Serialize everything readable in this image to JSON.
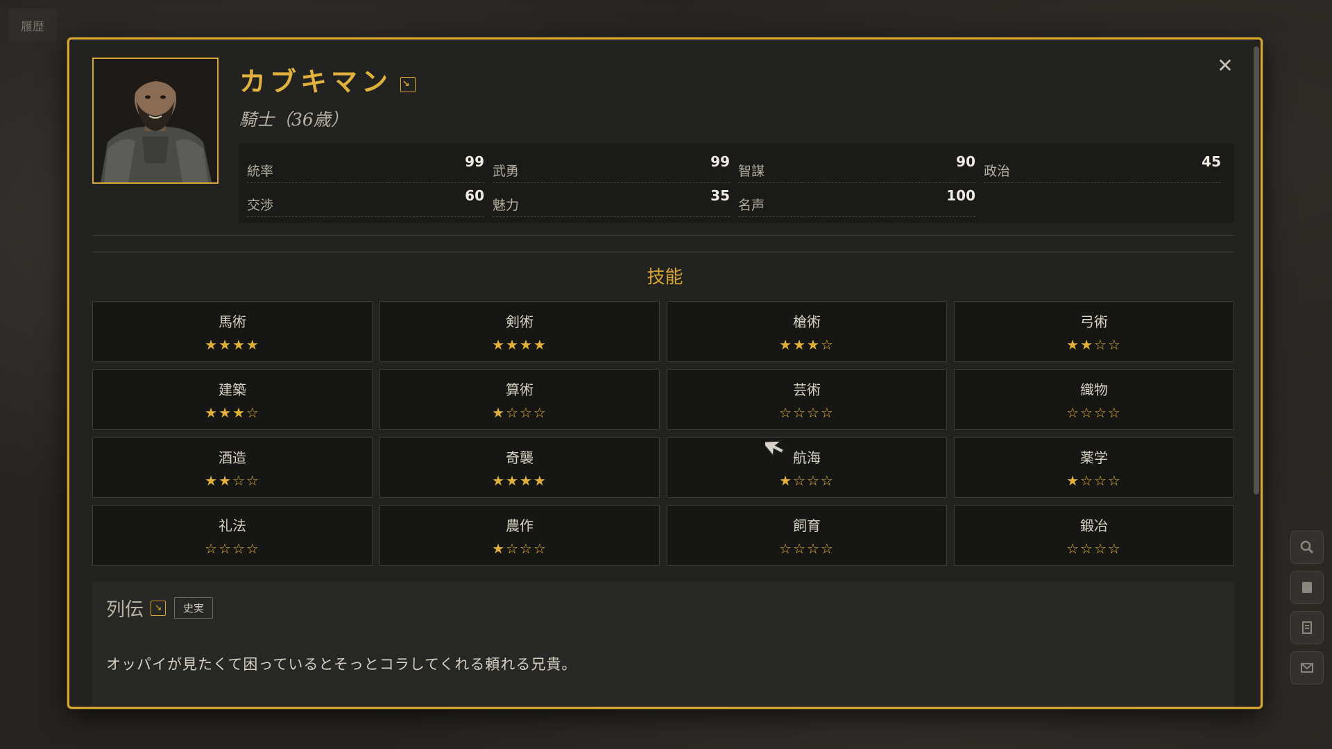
{
  "background": {
    "map_tab_label": "履歴"
  },
  "character": {
    "name": "カブキマン",
    "subtitle": "騎士（36歳）"
  },
  "stats": [
    {
      "label": "統率",
      "value": "99"
    },
    {
      "label": "武勇",
      "value": "99"
    },
    {
      "label": "智謀",
      "value": "90"
    },
    {
      "label": "政治",
      "value": "45"
    },
    {
      "label": "交渉",
      "value": "60"
    },
    {
      "label": "魅力",
      "value": "35"
    },
    {
      "label": "名声",
      "value": "100"
    }
  ],
  "skills_title": "技能",
  "skills": [
    {
      "name": "馬術",
      "stars": "★★★★"
    },
    {
      "name": "剣術",
      "stars": "★★★★"
    },
    {
      "name": "槍術",
      "stars": "★★★☆"
    },
    {
      "name": "弓術",
      "stars": "★★☆☆"
    },
    {
      "name": "建築",
      "stars": "★★★☆"
    },
    {
      "name": "算術",
      "stars": "★☆☆☆"
    },
    {
      "name": "芸術",
      "stars": "☆☆☆☆"
    },
    {
      "name": "織物",
      "stars": "☆☆☆☆"
    },
    {
      "name": "酒造",
      "stars": "★★☆☆"
    },
    {
      "name": "奇襲",
      "stars": "★★★★"
    },
    {
      "name": "航海",
      "stars": "★☆☆☆"
    },
    {
      "name": "薬学",
      "stars": "★☆☆☆"
    },
    {
      "name": "礼法",
      "stars": "☆☆☆☆"
    },
    {
      "name": "農作",
      "stars": "★☆☆☆"
    },
    {
      "name": "飼育",
      "stars": "☆☆☆☆"
    },
    {
      "name": "鍛冶",
      "stars": "☆☆☆☆"
    }
  ],
  "biography": {
    "title": "列伝",
    "tag": "史実",
    "text": "オッパイが見たくて困っているとそっとコラしてくれる頼れる兄貴。"
  },
  "icons": {
    "close": "close-icon",
    "link": "external-link-icon",
    "side_tools": [
      "search-icon",
      "scroll-icon",
      "document-icon",
      "mail-icon"
    ]
  },
  "colors": {
    "accent": "#d9a634",
    "panel": "#222221",
    "star": "#e2b13a"
  }
}
